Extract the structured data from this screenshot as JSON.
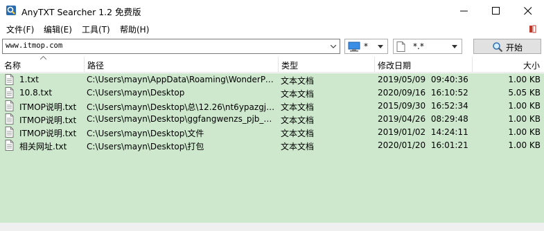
{
  "window": {
    "title": "AnyTXT Searcher 1.2 免费版"
  },
  "menu": {
    "file": "文件(F)",
    "edit": "编辑(E)",
    "tools": "工具(T)",
    "help": "帮助(H)"
  },
  "toolbar": {
    "search_value": "www.itmop.com",
    "drive_value": "*",
    "ext_value": "*.*",
    "start_label": "开始"
  },
  "columns": {
    "name": "名称",
    "path": "路径",
    "type": "类型",
    "date": "修改日期",
    "size": "大小"
  },
  "results": [
    {
      "name": "1.txt",
      "path": "C:\\Users\\mayn\\AppData\\Roaming\\WonderPe...",
      "type": "文本文档",
      "date": "2019/05/09",
      "time": "09:40:36",
      "size": "1.00 KB"
    },
    {
      "name": "10.8.txt",
      "path": "C:\\Users\\mayn\\Desktop",
      "type": "文本文档",
      "date": "2020/09/16",
      "time": "16:10:52",
      "size": "5.05 KB"
    },
    {
      "name": "ITMOP说明.txt",
      "path": "C:\\Users\\mayn\\Desktop\\总\\12.26\\nt6ypazgj_i...",
      "type": "文本文档",
      "date": "2015/09/30",
      "time": "16:52:34",
      "size": "1.00 KB"
    },
    {
      "name": "ITMOP说明.txt",
      "path": "C:\\Users\\mayn\\Desktop\\ggfangwenzs_pjb_v2...",
      "type": "文本文档",
      "date": "2019/04/26",
      "time": "08:29:48",
      "size": "1.00 KB"
    },
    {
      "name": "ITMOP说明.txt",
      "path": "C:\\Users\\mayn\\Desktop\\文件",
      "type": "文本文档",
      "date": "2019/01/02",
      "time": "14:24:11",
      "size": "1.00 KB"
    },
    {
      "name": "相关网址.txt",
      "path": "C:\\Users\\mayn\\Desktop\\打包",
      "type": "文本文档",
      "date": "2020/01/20",
      "time": "16:01:21",
      "size": "1.00 KB"
    }
  ],
  "colors": {
    "list_background": "#cde8cd",
    "accent": "#0078d7"
  }
}
